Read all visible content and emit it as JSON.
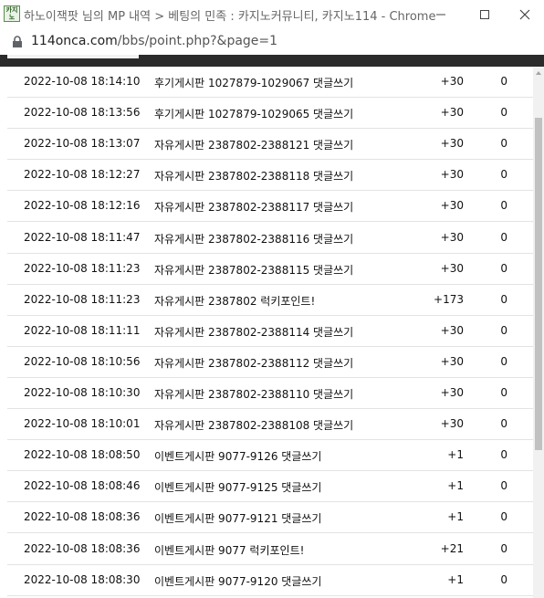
{
  "window": {
    "favicon_text": "카지노",
    "title": "하노이잭팟 님의 MP 내역 > 베팅의 민족 : 카지노커뮤니티, 카지노114 - Chrome"
  },
  "address": {
    "domain": "114onca.com",
    "path": "/bbs/point.php?&page=1"
  },
  "rows": [
    {
      "date": "2022-10-08 18:14:10",
      "desc": "후기게시판 1027879-1029067 댓글쓰기",
      "point": "+30",
      "use": "0"
    },
    {
      "date": "2022-10-08 18:13:56",
      "desc": "후기게시판 1027879-1029065 댓글쓰기",
      "point": "+30",
      "use": "0"
    },
    {
      "date": "2022-10-08 18:13:07",
      "desc": "자유게시판 2387802-2388121 댓글쓰기",
      "point": "+30",
      "use": "0"
    },
    {
      "date": "2022-10-08 18:12:27",
      "desc": "자유게시판 2387802-2388118 댓글쓰기",
      "point": "+30",
      "use": "0"
    },
    {
      "date": "2022-10-08 18:12:16",
      "desc": "자유게시판 2387802-2388117 댓글쓰기",
      "point": "+30",
      "use": "0"
    },
    {
      "date": "2022-10-08 18:11:47",
      "desc": "자유게시판 2387802-2388116 댓글쓰기",
      "point": "+30",
      "use": "0"
    },
    {
      "date": "2022-10-08 18:11:23",
      "desc": "자유게시판 2387802-2388115 댓글쓰기",
      "point": "+30",
      "use": "0"
    },
    {
      "date": "2022-10-08 18:11:23",
      "desc": "자유게시판 2387802 럭키포인트!",
      "point": "+173",
      "use": "0"
    },
    {
      "date": "2022-10-08 18:11:11",
      "desc": "자유게시판 2387802-2388114 댓글쓰기",
      "point": "+30",
      "use": "0"
    },
    {
      "date": "2022-10-08 18:10:56",
      "desc": "자유게시판 2387802-2388112 댓글쓰기",
      "point": "+30",
      "use": "0"
    },
    {
      "date": "2022-10-08 18:10:30",
      "desc": "자유게시판 2387802-2388110 댓글쓰기",
      "point": "+30",
      "use": "0"
    },
    {
      "date": "2022-10-08 18:10:01",
      "desc": "자유게시판 2387802-2388108 댓글쓰기",
      "point": "+30",
      "use": "0"
    },
    {
      "date": "2022-10-08 18:08:50",
      "desc": "이벤트게시판 9077-9126 댓글쓰기",
      "point": "+1",
      "use": "0"
    },
    {
      "date": "2022-10-08 18:08:46",
      "desc": "이벤트게시판 9077-9125 댓글쓰기",
      "point": "+1",
      "use": "0"
    },
    {
      "date": "2022-10-08 18:08:36",
      "desc": "이벤트게시판 9077-9121 댓글쓰기",
      "point": "+1",
      "use": "0"
    },
    {
      "date": "2022-10-08 18:08:36",
      "desc": "이벤트게시판 9077 럭키포인트!",
      "point": "+21",
      "use": "0"
    },
    {
      "date": "2022-10-08 18:08:30",
      "desc": "이벤트게시판 9077-9120 댓글쓰기",
      "point": "+1",
      "use": "0"
    }
  ]
}
